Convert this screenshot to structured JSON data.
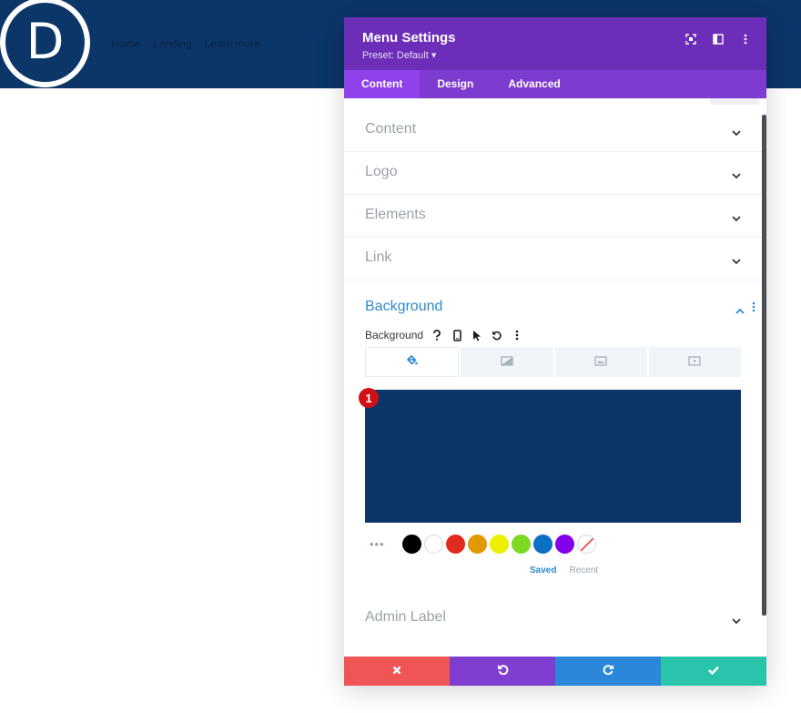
{
  "site": {
    "logo_letter": "D",
    "nav": [
      "Home",
      "Landing",
      "Learn more"
    ]
  },
  "modal": {
    "title": "Menu Settings",
    "preset": "Preset: Default ▾",
    "tabs": [
      {
        "label": "Content",
        "active": true
      },
      {
        "label": "Design",
        "active": false
      },
      {
        "label": "Advanced",
        "active": false
      }
    ]
  },
  "sections": {
    "content": "Content",
    "logo": "Logo",
    "elements": "Elements",
    "link": "Link",
    "background": "Background",
    "admin_label": "Admin Label"
  },
  "background_field": {
    "label": "Background",
    "marker": "1",
    "selected_color": "#0c3568",
    "swatches": [
      "#000000",
      "#ffffff",
      "#e02b20",
      "#e09900",
      "#edf000",
      "#7cda24",
      "#0c71c3",
      "#8300e9"
    ],
    "saved_label": "Saved",
    "recent_label": "Recent"
  },
  "colors": {
    "header_bg": "#6c2eb9",
    "tabs_bg": "#7e3bd0",
    "accent_blue": "#2e8ad0",
    "btn_cancel": "#ef5555",
    "btn_undo": "#7f3ed0",
    "btn_redo": "#2b87da",
    "btn_save": "#29c4a9"
  }
}
